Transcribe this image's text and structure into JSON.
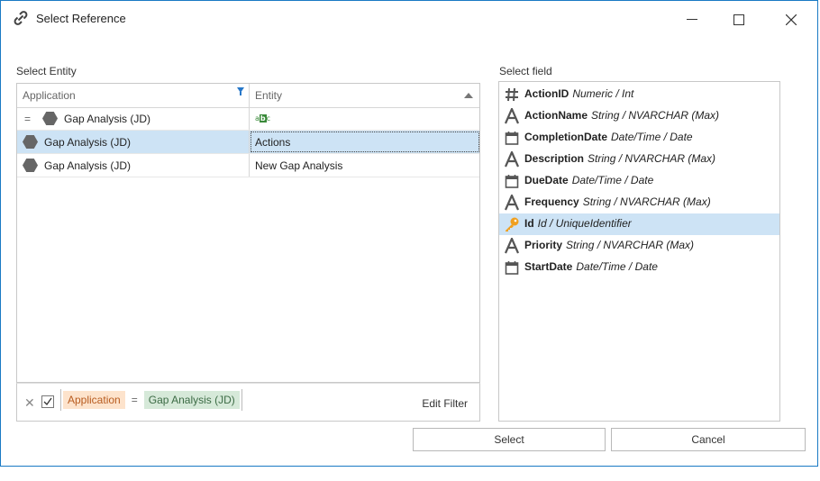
{
  "window": {
    "title": "Select Reference",
    "title_icon": "link-icon"
  },
  "entity_section": {
    "label": "Select Entity",
    "columns": [
      "Application",
      "Entity"
    ],
    "rows": [
      {
        "application": "Gap Analysis (JD)",
        "entity": "",
        "entity_icon": "abc-text-icon",
        "prefix": "="
      },
      {
        "application": "Gap Analysis (JD)",
        "entity": "Actions"
      },
      {
        "application": "Gap Analysis (JD)",
        "entity": "New Gap Analysis"
      }
    ],
    "filter": {
      "field": "Application",
      "operator": "=",
      "value": "Gap Analysis (JD)",
      "edit_label": "Edit Filter",
      "enabled": true
    }
  },
  "field_section": {
    "label": "Select field",
    "fields": [
      {
        "name": "ActionID",
        "type": "Numeric / Int",
        "icon": "hash-icon"
      },
      {
        "name": "ActionName",
        "type": "String / NVARCHAR (Max)",
        "icon": "text-a-icon"
      },
      {
        "name": "CompletionDate",
        "type": "Date/Time / Date",
        "icon": "calendar-icon"
      },
      {
        "name": "Description",
        "type": "String / NVARCHAR (Max)",
        "icon": "text-a-icon"
      },
      {
        "name": "DueDate",
        "type": "Date/Time / Date",
        "icon": "calendar-icon"
      },
      {
        "name": "Frequency",
        "type": "String / NVARCHAR (Max)",
        "icon": "text-a-icon"
      },
      {
        "name": "Id",
        "type": "Id / UniqueIdentifier",
        "icon": "key-icon"
      },
      {
        "name": "Priority",
        "type": "String / NVARCHAR (Max)",
        "icon": "text-a-icon"
      },
      {
        "name": "StartDate",
        "type": "Date/Time / Date",
        "icon": "calendar-icon"
      }
    ],
    "selected_index": 6
  },
  "buttons": {
    "select": "Select",
    "cancel": "Cancel"
  },
  "colors": {
    "accent": "#1a7ac4",
    "selection": "#cde3f5",
    "key": "#f0a020"
  }
}
